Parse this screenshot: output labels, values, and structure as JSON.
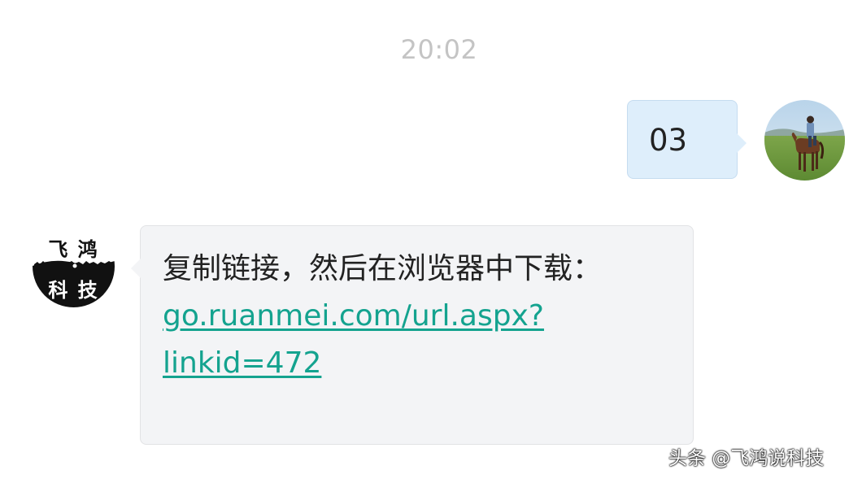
{
  "chat": {
    "timestamp": "20:02",
    "outgoing": {
      "text": "03",
      "avatar_icon": "user-avatar-horse-rider"
    },
    "incoming": {
      "line1": "复制链接，然后在浏览器中下载：",
      "link_line1": "go.ruanmei.com/url.aspx?",
      "link_line2": "linkid=472",
      "link_color": "#14a38f",
      "avatar": {
        "top_text": "飞 鸿",
        "bottom_text": "科 技"
      }
    },
    "watermark": {
      "text": "头条 @飞鸿说科技"
    }
  }
}
